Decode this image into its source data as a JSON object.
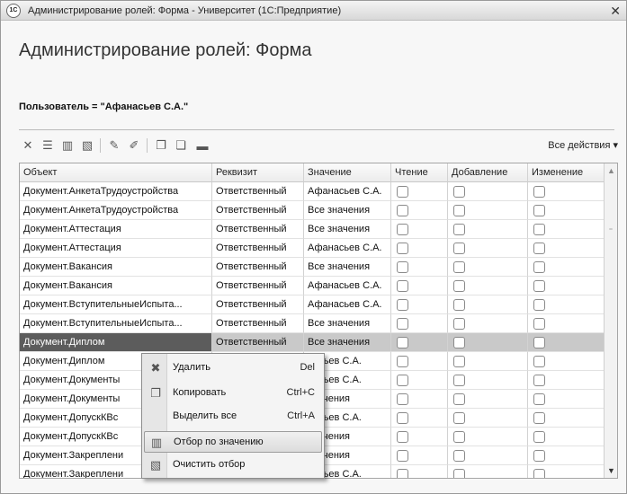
{
  "window": {
    "title": "Администрирование ролей: Форма - Университет  (1С:Предприятие)",
    "app_badge": "1С"
  },
  "form": {
    "title": "Администрирование ролей: Форма",
    "user_filter": "Пользователь = \"Афанасьев С.А.\""
  },
  "toolbar": {
    "all_actions": "Все действия ▾",
    "icons": [
      "delete-icon",
      "filter-list-icon",
      "filter-by-value-icon",
      "clear-filter-icon",
      "tag-icon",
      "tag-remove-icon",
      "copy-icon",
      "paste-icon",
      "dash-icon"
    ]
  },
  "table": {
    "columns": [
      "Объект",
      "Реквизит",
      "Значение",
      "Чтение",
      "Добавление",
      "Изменение"
    ],
    "rows": [
      {
        "object": "Документ.АнкетаТрудоустройства",
        "attribute": "Ответственный",
        "value": "Афанасьев С.А."
      },
      {
        "object": "Документ.АнкетаТрудоустройства",
        "attribute": "Ответственный",
        "value": "Все значения"
      },
      {
        "object": "Документ.Аттестация",
        "attribute": "Ответственный",
        "value": "Все значения"
      },
      {
        "object": "Документ.Аттестация",
        "attribute": "Ответственный",
        "value": "Афанасьев С.А."
      },
      {
        "object": "Документ.Вакансия",
        "attribute": "Ответственный",
        "value": "Все значения"
      },
      {
        "object": "Документ.Вакансия",
        "attribute": "Ответственный",
        "value": "Афанасьев С.А."
      },
      {
        "object": "Документ.ВступительныеИспыта...",
        "attribute": "Ответственный",
        "value": "Афанасьев С.А."
      },
      {
        "object": "Документ.ВступительныеИспыта...",
        "attribute": "Ответственный",
        "value": "Все значения"
      },
      {
        "object": "Документ.Диплом",
        "attribute": "Ответственный",
        "value": "Все значения"
      },
      {
        "object": "Документ.Диплом",
        "attribute": "",
        "value": "насьев С.А."
      },
      {
        "object": "Документ.Документы",
        "attribute": "",
        "value": "насьев С.А."
      },
      {
        "object": "Документ.Документы",
        "attribute": "",
        "value": "значения"
      },
      {
        "object": "Документ.ДопускКВс",
        "attribute": "",
        "value": "насьев С.А."
      },
      {
        "object": "Документ.ДопускКВс",
        "attribute": "",
        "value": "значения"
      },
      {
        "object": "Документ.Закреплени",
        "attribute": "",
        "value": "значения"
      },
      {
        "object": "Документ.Закреплени",
        "attribute": "",
        "value": "насьев С.А."
      }
    ]
  },
  "context_menu": {
    "items": [
      {
        "label": "Удалить",
        "shortcut": "Del",
        "icon": "delete-icon"
      },
      {
        "label": "Копировать",
        "shortcut": "Ctrl+C",
        "icon": "copy-icon"
      },
      {
        "label": "Выделить все",
        "shortcut": "Ctrl+A",
        "icon": ""
      },
      {
        "label": "Отбор по значению",
        "shortcut": "",
        "icon": "filter-by-value-icon"
      },
      {
        "label": "Очистить отбор",
        "shortcut": "",
        "icon": "clear-filter-icon"
      }
    ]
  }
}
